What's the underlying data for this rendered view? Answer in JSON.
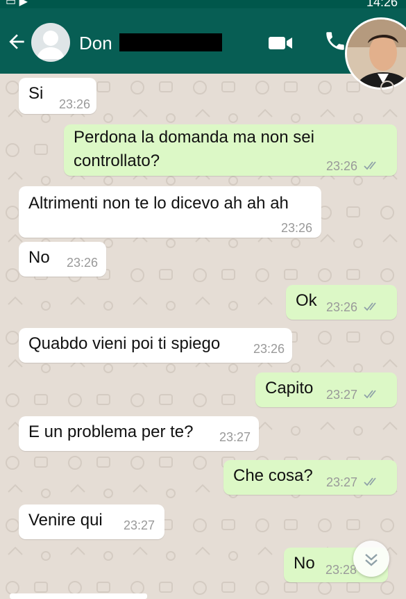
{
  "header": {
    "contact_name": "Don",
    "status_time": "14:26"
  },
  "messages": [
    {
      "dir": "in",
      "text": "Si",
      "time": "23:26"
    },
    {
      "dir": "out",
      "text": "Perdona la domanda ma non sei\ncontrollato?",
      "time": "23:26"
    },
    {
      "dir": "in",
      "text": "Altrimenti non te lo dicevo ah ah ah",
      "time": "23:26"
    },
    {
      "dir": "in",
      "text": "No",
      "time": "23:26"
    },
    {
      "dir": "out",
      "text": "Ok",
      "time": "23:26"
    },
    {
      "dir": "in",
      "text": "Quabdo vieni poi ti spiego",
      "time": "23:26"
    },
    {
      "dir": "out",
      "text": "Capito",
      "time": "23:27"
    },
    {
      "dir": "in",
      "text": "E un problema per te?",
      "time": "23:27"
    },
    {
      "dir": "out",
      "text": "Che cosa?",
      "time": "23:27"
    },
    {
      "dir": "in",
      "text": "Venire qui",
      "time": "23:27"
    },
    {
      "dir": "out",
      "text": "No",
      "time": "23:28"
    }
  ],
  "colors": {
    "header": "#075e54",
    "incoming_bubble": "#ffffff",
    "outgoing_bubble": "#dcf8c6",
    "chat_background": "#e5ddd5",
    "timestamp": "#999999"
  },
  "icons": [
    "back-arrow-icon",
    "video-call-icon",
    "phone-call-icon",
    "double-check-icon",
    "scroll-down-icon"
  ]
}
